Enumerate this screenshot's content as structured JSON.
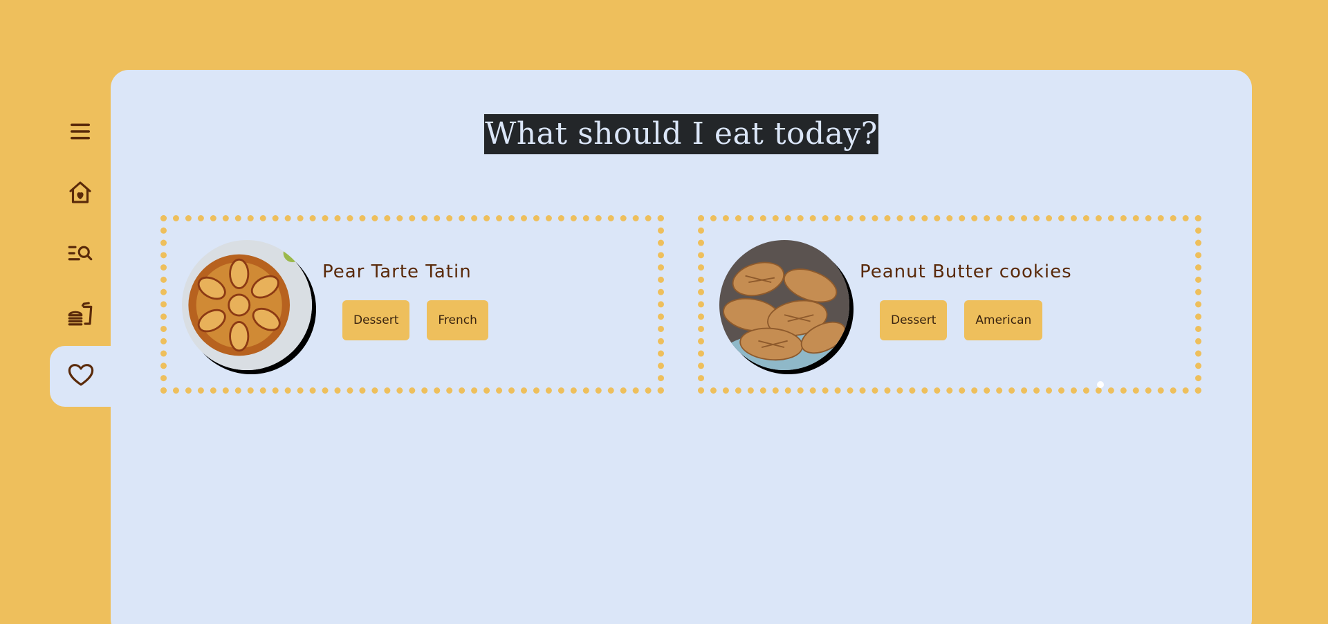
{
  "header": {
    "title": "What should I eat today?"
  },
  "sidebar": {
    "items": [
      {
        "icon": "menu-icon",
        "active": false
      },
      {
        "icon": "home-heart-icon",
        "active": false
      },
      {
        "icon": "search-list-icon",
        "active": false
      },
      {
        "icon": "fast-food-icon",
        "active": false
      },
      {
        "icon": "heart-icon",
        "active": true
      }
    ]
  },
  "recipes": [
    {
      "name": "Pear Tarte Tatin",
      "tags": [
        "Dessert",
        "French"
      ]
    },
    {
      "name": "Peanut Butter cookies",
      "tags": [
        "Dessert",
        "American"
      ]
    }
  ],
  "colors": {
    "background": "#EEBF5C",
    "panel": "#DBE6F8",
    "accent": "#EEBF5C",
    "icon": "#5A2A0A",
    "title_bg": "#232629"
  }
}
